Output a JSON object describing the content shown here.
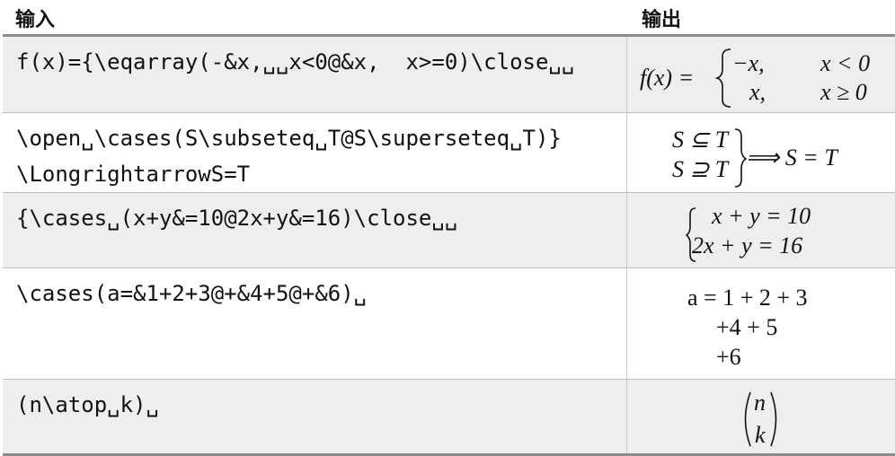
{
  "header": {
    "input": "输入",
    "output": "输出"
  },
  "rows": [
    {
      "input_lines": [
        "f(x)={\\eqarray(-&x,␣␣x<0@&x,  x>=0)\\close␣␣"
      ],
      "output": {
        "lhs": "f(x) =",
        "r1a": "−x,",
        "r1b": "x < 0",
        "r2a": "x,",
        "r2b": "x ≥ 0"
      }
    },
    {
      "input_lines": [
        "\\open␣\\cases(S\\subseteq␣T@S\\superseteq␣T)}",
        "\\LongrightarrowS=T"
      ],
      "output": {
        "r1": "S ⊆ T",
        "r2": "S ⊇ T",
        "rhs": "⟹ S = T"
      }
    },
    {
      "input_lines": [
        "{\\cases␣(x+y&=10@2x+y&=16)\\close␣␣"
      ],
      "output": {
        "r1": "x + y = 10",
        "r2": "2x + y = 16"
      }
    },
    {
      "input_lines": [
        "\\cases(a=&1+2+3@+&4+5@+&6)␣"
      ],
      "output": {
        "l1": "a = 1 + 2 + 3",
        "l2": "+4 + 5",
        "l3": "+6"
      }
    },
    {
      "input_lines": [
        "(n\\atop␣k)␣"
      ],
      "output": {
        "top": "n",
        "bottom": "k"
      }
    }
  ]
}
